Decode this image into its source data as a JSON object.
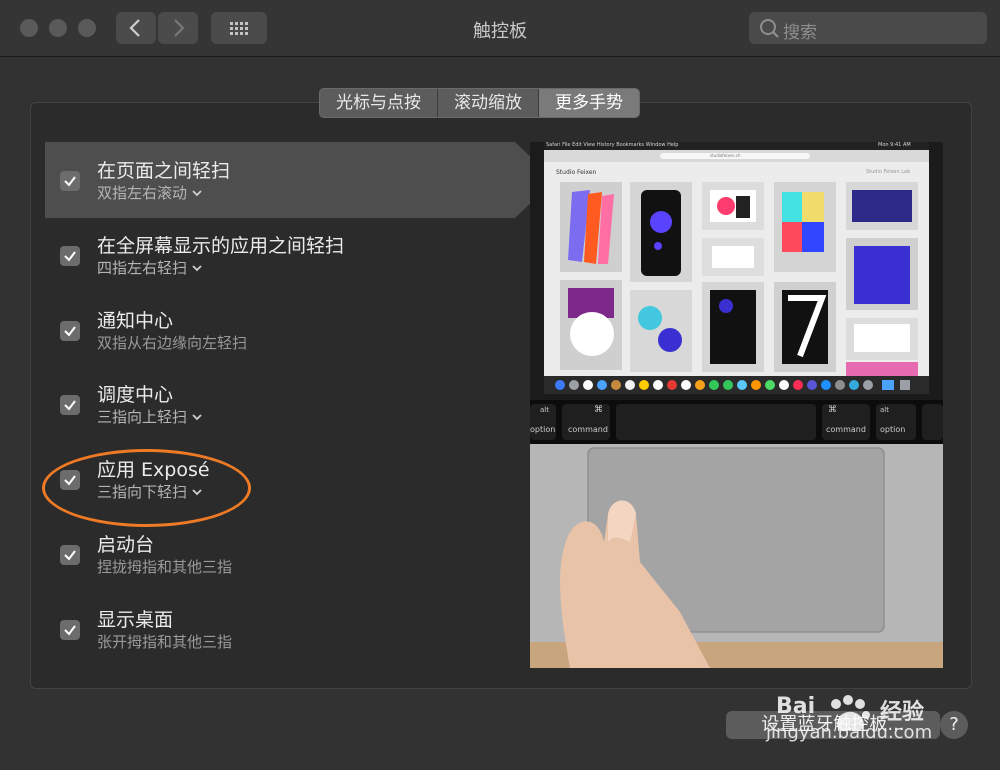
{
  "window": {
    "title": "触控板"
  },
  "search": {
    "placeholder": "搜索"
  },
  "tabs": [
    {
      "label": "光标与点按",
      "active": false
    },
    {
      "label": "滚动缩放",
      "active": false
    },
    {
      "label": "更多手势",
      "active": true
    }
  ],
  "gestures": [
    {
      "title": "在页面之间轻扫",
      "subtitle": "双指左右滚动",
      "checked": true,
      "dropdown": true,
      "selected": true
    },
    {
      "title": "在全屏幕显示的应用之间轻扫",
      "subtitle": "四指左右轻扫",
      "checked": true,
      "dropdown": true,
      "selected": false
    },
    {
      "title": "通知中心",
      "subtitle": "双指从右边缘向左轻扫",
      "checked": true,
      "dropdown": false,
      "selected": false
    },
    {
      "title": "调度中心",
      "subtitle": "三指向上轻扫",
      "checked": true,
      "dropdown": true,
      "selected": false
    },
    {
      "title": "应用 Exposé",
      "subtitle": "三指向下轻扫",
      "checked": true,
      "dropdown": true,
      "selected": false
    },
    {
      "title": "启动台",
      "subtitle": "捏拢拇指和其他三指",
      "checked": true,
      "dropdown": false,
      "selected": false
    },
    {
      "title": "显示桌面",
      "subtitle": "张开拇指和其他三指",
      "checked": true,
      "dropdown": false,
      "selected": false
    }
  ],
  "preview": {
    "menubar": [
      "Safari",
      "File",
      "Edit",
      "View",
      "History",
      "Bookmarks",
      "Window",
      "Help"
    ],
    "clock": "Mon 9:41 AM",
    "url": "studiofeixen.ch",
    "site_title": "Studio Feixen",
    "site_right": "Studio Feixen Lab",
    "keys": [
      {
        "top": "alt",
        "bottom": "option"
      },
      {
        "top": "⌘",
        "bottom": "command"
      },
      {
        "top": "⌘",
        "bottom": "command"
      },
      {
        "top": "alt",
        "bottom": "option"
      }
    ]
  },
  "footer": {
    "bluetooth_button": "设置蓝牙触控板...",
    "help": "?"
  },
  "watermark": {
    "brand": "Bai",
    "brand_cn": "经验",
    "url": "jingyan.baidu.com"
  },
  "colors": {
    "highlight_ring": "#ee7a25",
    "selected_row": "#4e4e4e"
  }
}
